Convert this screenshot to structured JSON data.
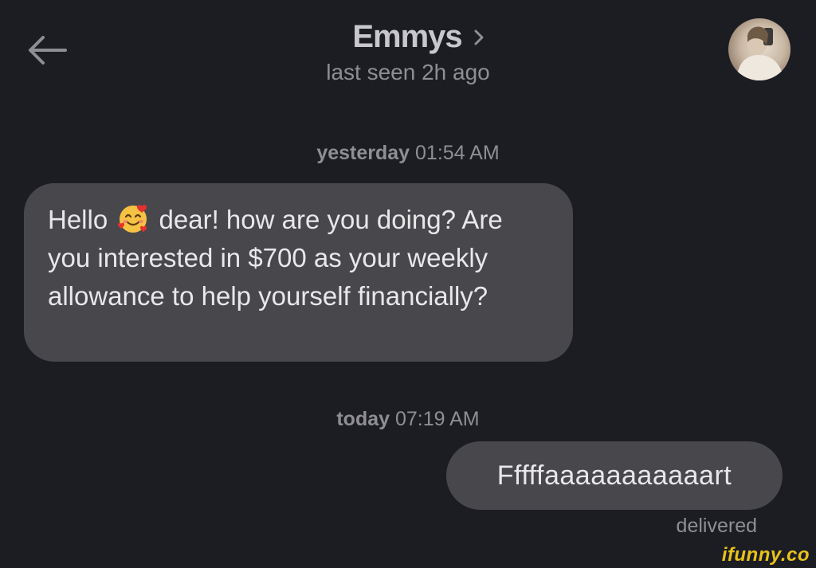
{
  "header": {
    "contact_name": "Emmys",
    "status": "last seen 2h ago",
    "avatar_icon": "profile-photo"
  },
  "messages": [
    {
      "timestamp_day": "yesterday",
      "timestamp_time": "01:54 AM",
      "direction": "incoming",
      "text_before_emoji": "Hello",
      "emoji": "smiling-face-with-hearts",
      "text_after_emoji": "dear! how are you doing?",
      "text_rest": "Are you interested in $700 as your weekly allowance to help yourself financially?"
    },
    {
      "timestamp_day": "today",
      "timestamp_time": "07:19 AM",
      "direction": "outgoing",
      "text": "Fffffaaaaaaaaaaart",
      "status": "delivered"
    }
  ],
  "watermark": "ifunny.co",
  "colors": {
    "background": "#1c1d22",
    "bubble": "#48484c",
    "primary_text": "#e8e8ea",
    "secondary_text": "#8e8e93",
    "watermark": "#e8c21a"
  }
}
